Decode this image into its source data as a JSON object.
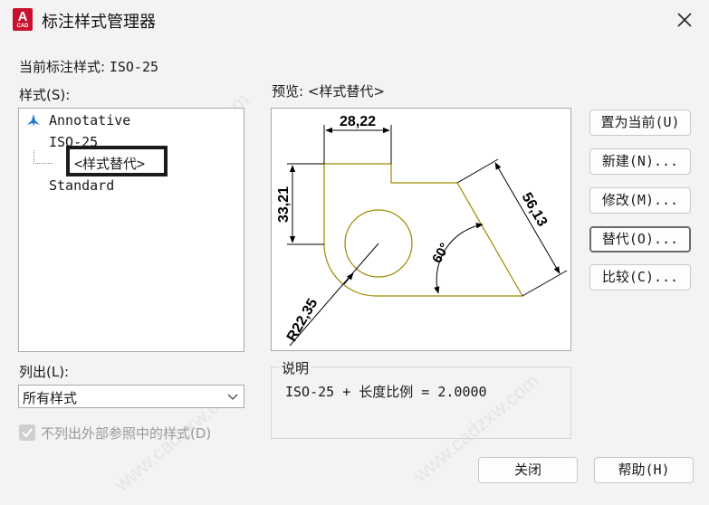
{
  "window": {
    "title": "标注样式管理器",
    "icon": {
      "name": "autocad-icon",
      "letter": "A",
      "sub": "CAD",
      "color": "#c8102e"
    }
  },
  "current_style": {
    "label": "当前标注样式:",
    "value": "ISO-25"
  },
  "styles_panel": {
    "label": "样式(S):",
    "items": [
      {
        "name": "Annotative",
        "icon": "annotative-icon"
      },
      {
        "name": "ISO-25"
      },
      {
        "name": "<样式替代>",
        "selected": true
      },
      {
        "name": "Standard"
      }
    ]
  },
  "list_filter": {
    "label": "列出(L):",
    "value": "所有样式"
  },
  "exclude_xref": {
    "label": "不列出外部参照中的样式(D)",
    "checked": true,
    "disabled": true
  },
  "preview": {
    "label": "预览: <样式替代>",
    "dims": {
      "horizontal": "28,22",
      "vertical": "33,21",
      "aligned": "56,13",
      "angle": "60°",
      "radius": "R22,35"
    },
    "geometry_color": "#9c8a00"
  },
  "description": {
    "label": "说明",
    "text": "ISO-25 + 长度比例 = 2.0000"
  },
  "buttons": {
    "set_current": "置为当前(U)",
    "new": "新建(N)...",
    "modify": "修改(M)...",
    "override": "替代(O)...",
    "compare": "比较(C)...",
    "close": "关闭",
    "help": "帮助(H)"
  }
}
